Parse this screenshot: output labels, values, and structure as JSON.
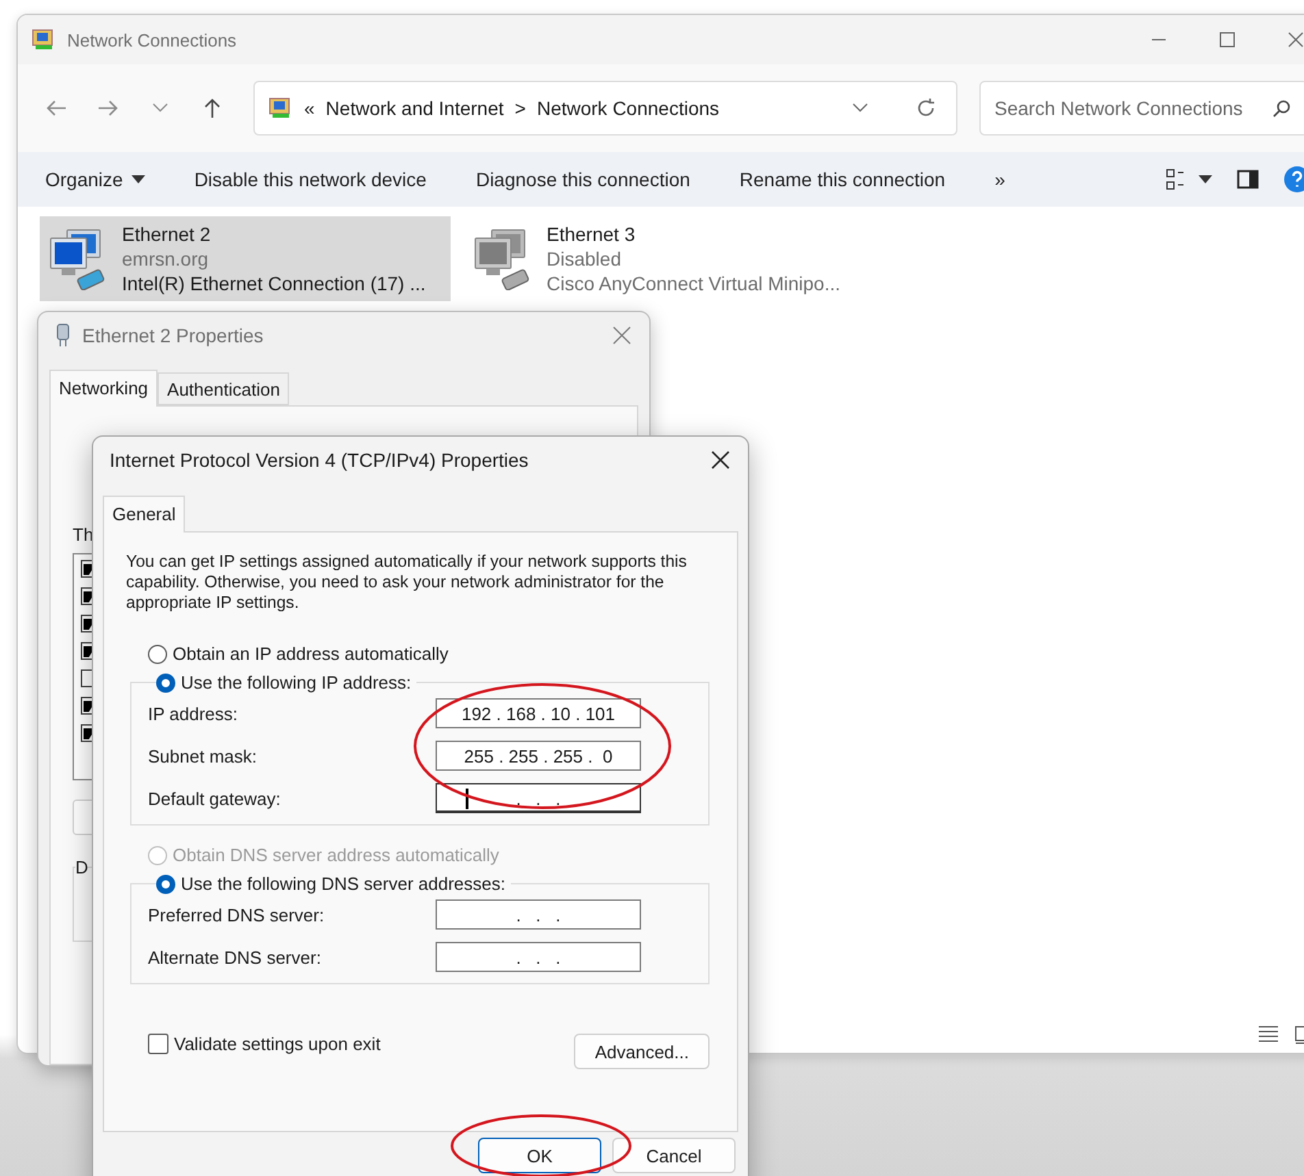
{
  "explorer": {
    "title": "Network Connections",
    "breadcrumb_overflow": "«",
    "breadcrumb": [
      {
        "label": "Network and Internet"
      },
      {
        "label": "Network Connections"
      }
    ],
    "breadcrumb_separator": ">",
    "search": {
      "placeholder": "Search Network Connections"
    },
    "commands": [
      {
        "label": "Organize",
        "kind": "menu"
      },
      {
        "label": "Disable this network device",
        "kind": "plain"
      },
      {
        "label": "Diagnose this connection",
        "kind": "plain"
      },
      {
        "label": "Rename this connection",
        "kind": "plain"
      },
      {
        "label": "»",
        "kind": "plain"
      }
    ],
    "connections": [
      {
        "name": "Ethernet 2",
        "status": "emrsn.org",
        "adapter": "Intel(R) Ethernet Connection (17) ...",
        "selected": true,
        "disabled": false
      },
      {
        "name": "Ethernet 3",
        "status": "Disabled",
        "adapter": "Cisco AnyConnect Virtual Minipo...",
        "selected": false,
        "disabled": true
      }
    ]
  },
  "properties": {
    "title": "Ethernet 2 Properties",
    "tabs": [
      {
        "label": "Networking",
        "selected": true
      },
      {
        "label": "Authentication",
        "selected": false
      }
    ],
    "items_label": "Th",
    "items": [
      {
        "checked": true
      },
      {
        "checked": true
      },
      {
        "checked": true
      },
      {
        "checked": true
      },
      {
        "checked": false
      },
      {
        "checked": true
      },
      {
        "checked": true
      }
    ],
    "group_label": "D"
  },
  "ipv4": {
    "title": "Internet Protocol Version 4 (TCP/IPv4) Properties",
    "tabs": [
      {
        "label": "General",
        "selected": true
      }
    ],
    "intro": "You can get IP settings assigned automatically if your network supports this capability. Otherwise, you need to ask your network administrator for the appropriate IP settings.",
    "ip_auto": {
      "label": "Obtain an IP address automatically",
      "selected": false,
      "disabled": false
    },
    "ip_manual": {
      "label": "Use the following IP address:",
      "selected": true,
      "disabled": false
    },
    "ip_fields": [
      {
        "label": "IP address:",
        "value": "192 . 168 . 10 . 101",
        "focused": false
      },
      {
        "label": "Subnet mask:",
        "value": "255 . 255 . 255 .  0",
        "focused": false
      },
      {
        "label": "Default gateway:",
        "value": ".   .   .",
        "focused": true
      }
    ],
    "dns_auto": {
      "label": "Obtain DNS server address automatically",
      "selected": false,
      "disabled": true
    },
    "dns_manual": {
      "label": "Use the following DNS server addresses:",
      "selected": true,
      "disabled": false
    },
    "dns_fields": [
      {
        "label": "Preferred DNS server:",
        "value": ".   .   .",
        "focused": false
      },
      {
        "label": "Alternate DNS server:",
        "value": ".   .   .",
        "focused": false
      }
    ],
    "validate": {
      "label": "Validate settings upon exit",
      "checked": false
    },
    "advanced": {
      "label": "Advanced..."
    },
    "buttons": [
      {
        "label": "OK",
        "default": true
      },
      {
        "label": "Cancel",
        "default": false
      }
    ]
  }
}
